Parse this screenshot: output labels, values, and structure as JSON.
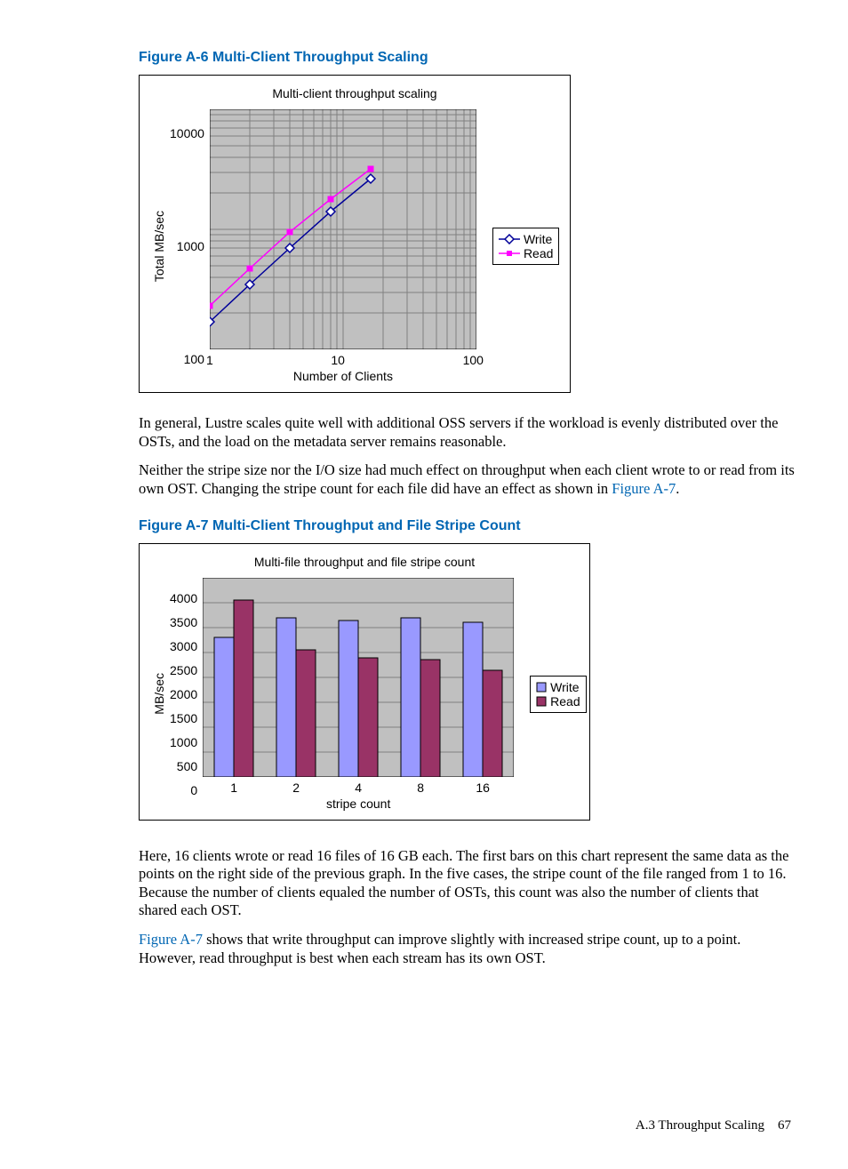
{
  "fig_a6": {
    "title": "Figure A-6 Multi-Client Throughput Scaling",
    "chart_title": "Multi-client throughput scaling",
    "ylabel": "Total MB/sec",
    "xlabel": "Number of Clients",
    "xticks": [
      "1",
      "10",
      "100"
    ],
    "yticks": [
      "100",
      "1000",
      "10000"
    ],
    "legend": {
      "write": "Write",
      "read": "Read"
    }
  },
  "para1": "In general, Lustre scales quite well with additional OSS servers if the workload is evenly distributed over the OSTs, and the load on the metadata server remains reasonable.",
  "para2a": "Neither the stripe size nor the I/O size had much effect on throughput when each client wrote to or read from its own OST. Changing the stripe count for each file did have an effect as shown in ",
  "para2link": "Figure A-7",
  "para2b": ".",
  "fig_a7": {
    "title": "Figure A-7 Multi-Client Throughput and File Stripe Count",
    "chart_title": "Multi-file throughput and file stripe count",
    "ylabel": "MB/sec",
    "xlabel": "stripe count",
    "xticks": [
      "1",
      "2",
      "4",
      "8",
      "16"
    ],
    "yticks": [
      "0",
      "500",
      "1000",
      "1500",
      "2000",
      "2500",
      "3000",
      "3500",
      "4000"
    ],
    "legend": {
      "write": "Write",
      "read": "Read"
    }
  },
  "para3": "Here, 16 clients wrote or read 16 files of 16 GB each. The first bars on this chart represent the same data as the points on the right side of the previous graph. In the five cases, the stripe count of the file ranged from 1 to 16. Because the number of clients equaled the number of OSTs, this count was also the number of clients that shared each OST.",
  "para4link": "Figure A-7",
  "para4": " shows that write throughput can improve slightly with increased stripe count, up to a point. However, read throughput is best when each stream has its own OST.",
  "footer_section": "A.3 Throughput Scaling",
  "footer_page": "67",
  "chart_data": [
    {
      "type": "line",
      "title": "Multi-client throughput scaling",
      "xlabel": "Number of Clients",
      "ylabel": "Total MB/sec",
      "xscale": "log",
      "yscale": "log",
      "xticks": [
        1,
        10,
        100
      ],
      "yticks": [
        100,
        1000,
        10000
      ],
      "x": [
        1,
        2,
        4,
        8,
        16
      ],
      "series": [
        {
          "name": "Write",
          "values": [
            170,
            350,
            700,
            1400,
            2650
          ],
          "color": "#000099",
          "marker": "diamond-open"
        },
        {
          "name": "Read",
          "values": [
            230,
            470,
            950,
            1800,
            3200
          ],
          "color": "#ff00ff",
          "marker": "square"
        }
      ]
    },
    {
      "type": "bar",
      "title": "Multi-file throughput and file stripe count",
      "xlabel": "stripe count",
      "ylabel": "MB/sec",
      "categories": [
        "1",
        "2",
        "4",
        "8",
        "16"
      ],
      "ylim": [
        0,
        4000
      ],
      "series": [
        {
          "name": "Write",
          "values": [
            2800,
            3200,
            3150,
            3200,
            3100
          ],
          "color": "#9999ff"
        },
        {
          "name": "Read",
          "values": [
            3550,
            2550,
            2400,
            2350,
            2150
          ],
          "color": "#993366"
        }
      ]
    }
  ]
}
